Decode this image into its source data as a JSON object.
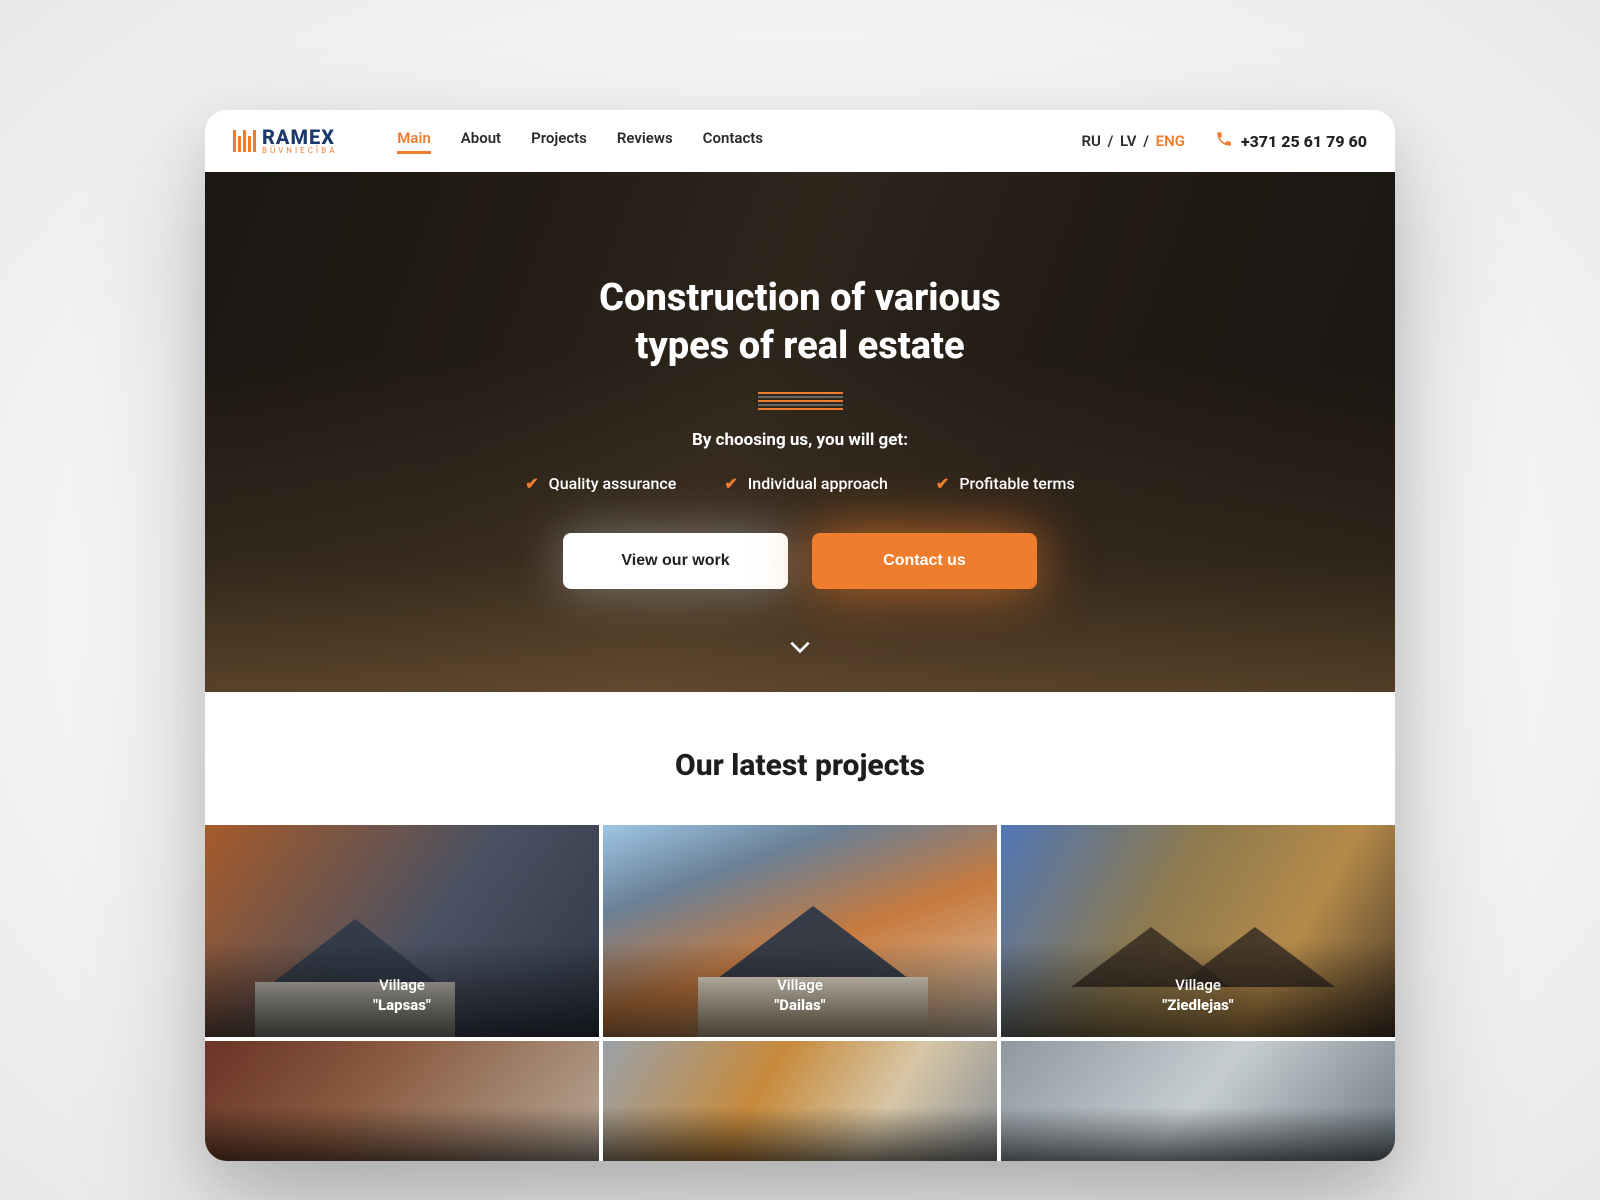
{
  "logo": {
    "name": "RAMEX",
    "tag": "BŪVNIECĪBA"
  },
  "nav": {
    "items": [
      {
        "label": "Main",
        "active": true
      },
      {
        "label": "About"
      },
      {
        "label": "Projects"
      },
      {
        "label": "Reviews"
      },
      {
        "label": "Contacts"
      }
    ]
  },
  "lang": {
    "ru": "RU",
    "lv": "LV",
    "eng": "ENG",
    "active": "ENG"
  },
  "phone": "+371 25 61 79 60",
  "hero": {
    "title_line1": "Construction of various",
    "title_line2": "types of real estate",
    "subtitle": "By choosing us, you will get:",
    "benefits": [
      "Quality assurance",
      "Individual approach",
      "Profitable terms"
    ],
    "btn_primary": "View our work",
    "btn_secondary": "Contact us"
  },
  "projects": {
    "heading": "Our latest projects",
    "items": [
      {
        "prefix": "Village",
        "name": "\"Lapsas\""
      },
      {
        "prefix": "Village",
        "name": "\"Dailas\""
      },
      {
        "prefix": "Village",
        "name": "\"Ziedlejas\""
      }
    ]
  },
  "colors": {
    "accent": "#f07d2e",
    "dark": "#1e1e1e"
  }
}
